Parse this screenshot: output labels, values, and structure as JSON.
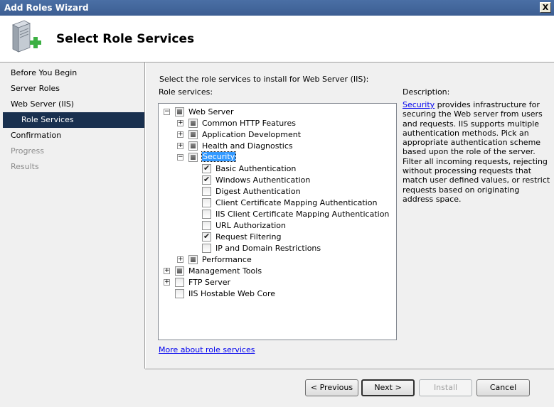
{
  "window": {
    "title": "Add Roles Wizard",
    "close_label": "X"
  },
  "header": {
    "title": "Select Role Services"
  },
  "sidebar": {
    "items": [
      {
        "label": "Before You Begin",
        "state": "normal"
      },
      {
        "label": "Server Roles",
        "state": "normal"
      },
      {
        "label": "Web Server (IIS)",
        "state": "normal"
      },
      {
        "label": "Role Services",
        "state": "active"
      },
      {
        "label": "Confirmation",
        "state": "normal"
      },
      {
        "label": "Progress",
        "state": "disabled"
      },
      {
        "label": "Results",
        "state": "disabled"
      }
    ]
  },
  "main": {
    "instruction": "Select the role services to install for Web Server (IIS):",
    "role_services_label": "Role services:",
    "description_label": "Description:",
    "description_link": "Security",
    "description_text": " provides infrastructure for securing the Web server from users and requests. IIS supports multiple authentication methods. Pick an appropriate authentication scheme based upon the role of the server. Filter all incoming requests, rejecting without processing requests that match user defined values, or restrict requests based on originating address space.",
    "more_link": "More about role services"
  },
  "tree": [
    {
      "label": "Web Server",
      "level": 0,
      "expander": "minus",
      "check": "partial"
    },
    {
      "label": "Common HTTP Features",
      "level": 1,
      "expander": "plus",
      "check": "partial"
    },
    {
      "label": "Application Development",
      "level": 1,
      "expander": "plus",
      "check": "partial"
    },
    {
      "label": "Health and Diagnostics",
      "level": 1,
      "expander": "plus",
      "check": "partial"
    },
    {
      "label": "Security",
      "level": 1,
      "expander": "minus",
      "check": "partial",
      "selected": true
    },
    {
      "label": "Basic Authentication",
      "level": 2,
      "expander": "none",
      "check": "checked"
    },
    {
      "label": "Windows Authentication",
      "level": 2,
      "expander": "none",
      "check": "checked"
    },
    {
      "label": "Digest Authentication",
      "level": 2,
      "expander": "none",
      "check": "unchecked"
    },
    {
      "label": "Client Certificate Mapping Authentication",
      "level": 2,
      "expander": "none",
      "check": "unchecked"
    },
    {
      "label": "IIS Client Certificate Mapping Authentication",
      "level": 2,
      "expander": "none",
      "check": "unchecked"
    },
    {
      "label": "URL Authorization",
      "level": 2,
      "expander": "none",
      "check": "unchecked"
    },
    {
      "label": "Request Filtering",
      "level": 2,
      "expander": "none",
      "check": "checked"
    },
    {
      "label": "IP and Domain Restrictions",
      "level": 2,
      "expander": "none",
      "check": "unchecked"
    },
    {
      "label": "Performance",
      "level": 1,
      "expander": "plus",
      "check": "partial"
    },
    {
      "label": "Management Tools",
      "level": 0,
      "expander": "plus",
      "check": "partial"
    },
    {
      "label": "FTP Server",
      "level": 0,
      "expander": "plus",
      "check": "unchecked"
    },
    {
      "label": "IIS Hostable Web Core",
      "level": 0,
      "expander": "none",
      "check": "unchecked"
    }
  ],
  "buttons": {
    "previous": "< Previous",
    "next": "Next >",
    "install": "Install",
    "cancel": "Cancel"
  },
  "icons": {
    "header": "server-add-icon",
    "close": "close-icon"
  },
  "colors": {
    "active_nav": "#19304f",
    "link": "#0000ee",
    "selection": "#3399ff",
    "plus_green": "#3cb043"
  }
}
